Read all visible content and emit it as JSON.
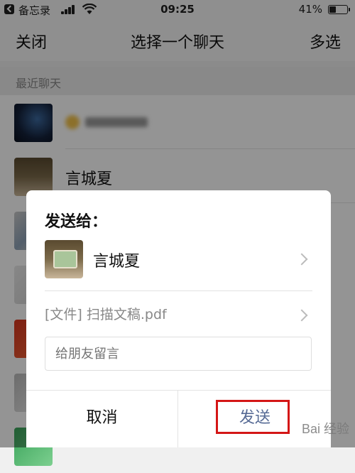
{
  "status_bar": {
    "app_label": "备忘录",
    "time": "09:25",
    "battery_percent": "41%",
    "battery_level": 0.41
  },
  "nav": {
    "close_label": "关闭",
    "title": "选择一个聊天",
    "multi_select_label": "多选"
  },
  "list": {
    "section_header": "最近聊天",
    "chats": [
      {
        "name": "",
        "blurred": true
      },
      {
        "name": "言城夏",
        "blurred": false
      }
    ]
  },
  "dialog": {
    "title": "发送给：",
    "recipient_name": "言城夏",
    "file_label": "[文件] 扫描文稿.pdf",
    "message_placeholder": "给朋友留言",
    "cancel_label": "取消",
    "send_label": "发送"
  },
  "watermark": "Bai 经验",
  "colors": {
    "send_text": "#576b95",
    "highlight_border": "#d41616"
  }
}
